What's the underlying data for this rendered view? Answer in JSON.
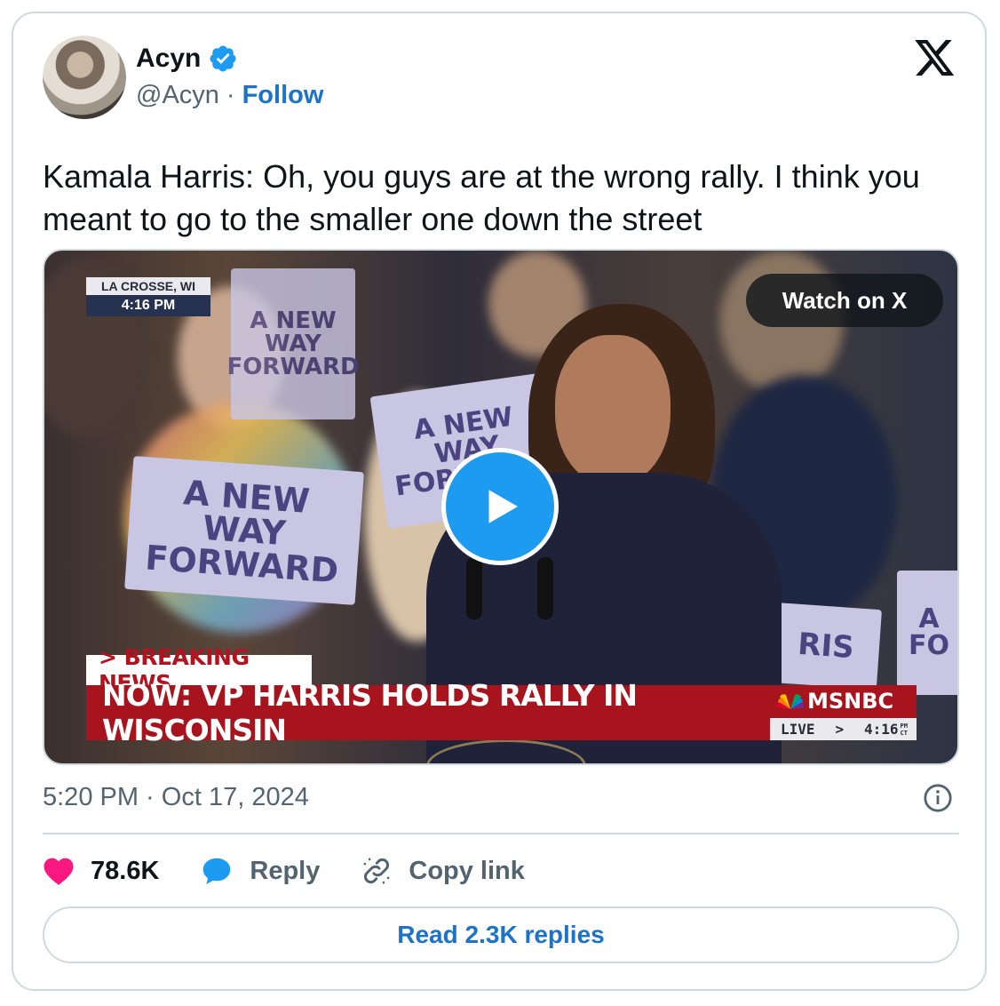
{
  "author": {
    "name": "Acyn",
    "handle": "@Acyn",
    "separator": "·",
    "follow_label": "Follow",
    "verified": true
  },
  "tweet": {
    "text": "Kamala Harris: Oh, you guys are at the wrong rally. I think you meant to go to the smaller one down the street"
  },
  "media": {
    "watch_label": "Watch on X",
    "location": "LA CROSSE, WI",
    "location_time": "4:16 PM",
    "breaking_label": "> BREAKING NEWS",
    "headline": "NOW: VP HARRIS HOLDS RALLY IN WISCONSIN",
    "network": "MSNBC",
    "live_label": "LIVE",
    "live_arrow": ">",
    "live_time": "4:16",
    "live_tz_top": "PM",
    "live_tz_bottom": "CT",
    "signs": [
      "A NEW WAY FORWARD",
      "A NEW WAY FORWARD",
      "A NEW WAY FORWARD",
      "RIS",
      "A FO"
    ]
  },
  "meta": {
    "timestamp": "5:20 PM · Oct 17, 2024"
  },
  "actions": {
    "likes": "78.6K",
    "reply_label": "Reply",
    "copy_label": "Copy link"
  },
  "footer": {
    "read_replies_label": "Read 2.3K replies"
  },
  "colors": {
    "accent": "#1d9bf0",
    "link": "#1d72c9",
    "like": "#f91880",
    "border": "#cfd9de",
    "muted": "#536471",
    "breaking_red": "#a8141e"
  },
  "icons": [
    "verified-badge-icon",
    "x-logo-icon",
    "play-icon",
    "info-icon",
    "heart-icon",
    "reply-bubble-icon",
    "link-icon"
  ]
}
